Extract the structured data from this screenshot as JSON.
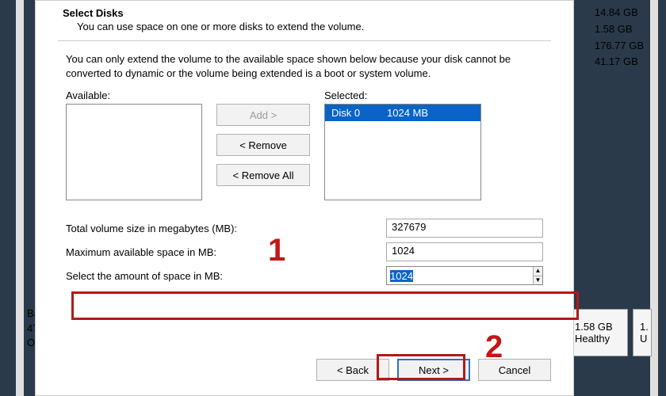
{
  "header": {
    "title": "Select Disks",
    "subtitle": "You can use space on one or more disks to extend the volume."
  },
  "info": "You can only extend the volume to the available space shown below because your disk cannot be converted to dynamic or the volume being extended is a boot or system volume.",
  "labels": {
    "available": "Available:",
    "selected": "Selected:",
    "add": "Add >",
    "remove": "< Remove",
    "remove_all": "< Remove All",
    "total": "Total volume size in megabytes (MB):",
    "max": "Maximum available space in MB:",
    "amount": "Select the amount of space in MB:",
    "back": "< Back",
    "next": "Next >",
    "cancel": "Cancel"
  },
  "selected_item": {
    "disk": "Disk 0",
    "size": "1024 MB"
  },
  "values": {
    "total": "327679",
    "max": "1024",
    "amount": "1024"
  },
  "side_sizes": [
    "14.84 GB",
    "1.58 GB",
    "176.77 GB",
    "41.17 GB"
  ],
  "bottom_panel": {
    "a1": "1.58 GB",
    "a2": "Healthy",
    "b1": "1.",
    "b2": "U"
  },
  "left_bottom": {
    "l1": "Ba",
    "l2": "47",
    "l3": "On"
  },
  "annot": {
    "one": "1",
    "two": "2"
  }
}
